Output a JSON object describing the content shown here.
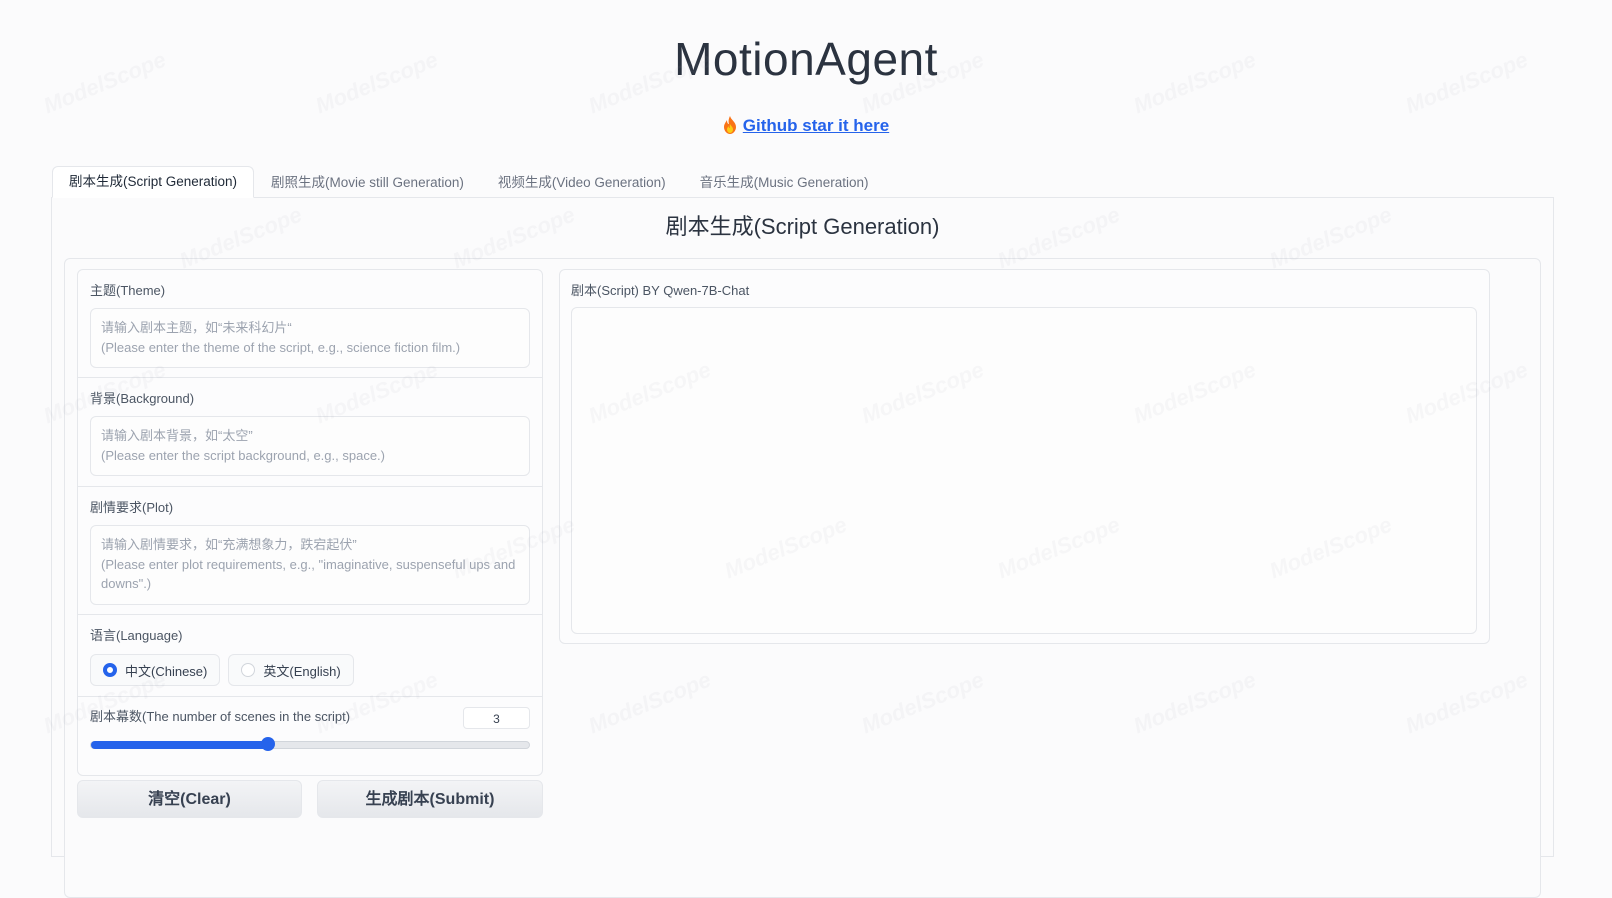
{
  "app": {
    "title": "MotionAgent",
    "star_link": "Github star it here"
  },
  "tabs": [
    {
      "label": "剧本生成(Script Generation)",
      "active": true
    },
    {
      "label": "剧照生成(Movie still Generation)",
      "active": false
    },
    {
      "label": "视频生成(Video Generation)",
      "active": false
    },
    {
      "label": "音乐生成(Music Generation)",
      "active": false
    }
  ],
  "panel": {
    "title": "剧本生成(Script Generation)"
  },
  "form": {
    "theme": {
      "label": "主题(Theme)",
      "placeholder": "请输入剧本主题，如“未来科幻片“\n(Please enter the theme of the script, e.g., science fiction film.)"
    },
    "background": {
      "label": "背景(Background)",
      "placeholder": "请输入剧本背景，如“太空”\n(Please enter the script background, e.g., space.)"
    },
    "plot": {
      "label": "剧情要求(Plot)",
      "placeholder": "请输入剧情要求，如“充满想象力，跌宕起伏”\n(Please enter plot requirements, e.g., \"imaginative, suspenseful ups and downs\".)"
    },
    "language": {
      "label": "语言(Language)",
      "options": [
        {
          "label": "中文(Chinese)",
          "selected": true
        },
        {
          "label": "英文(English)",
          "selected": false
        }
      ]
    },
    "scenes": {
      "label": "剧本幕数(The number of scenes in the script)",
      "value": "3",
      "fraction": 0.405
    },
    "clear_label": "清空(Clear)",
    "submit_label": "生成剧本(Submit)"
  },
  "output": {
    "label": "剧本(Script) BY Qwen-7B-Chat"
  },
  "colors": {
    "accent": "#2563eb",
    "link": "#2563eb"
  },
  "icons": {
    "star_prefix": "fire-icon"
  },
  "watermark": "ModelScope"
}
